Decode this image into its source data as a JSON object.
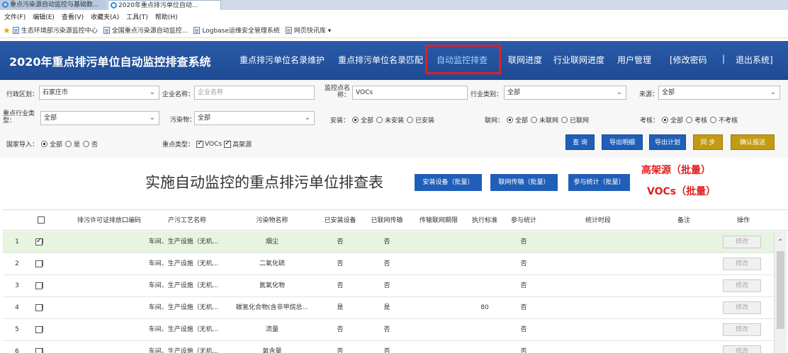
{
  "browser": {
    "tabs": [
      "重点污染源自动监控与基础数...",
      "2020年重点排污单位自动..."
    ],
    "menu": [
      "文件(F)",
      "编辑(E)",
      "查看(V)",
      "收藏夹(A)",
      "工具(T)",
      "帮助(H)"
    ],
    "favorites": [
      "生态环境部污染源监控中心",
      "全国重点污染源自动监控...",
      "Logbase运维安全管理系统",
      "网页快讯库 ▾"
    ]
  },
  "header": {
    "title": "2020年重点排污单位自动监控排查系统",
    "nav": [
      "重点排污单位名录维护",
      "重点排污单位名录匹配",
      "自动监控排查",
      "联网进度",
      "行业联网进度",
      "用户管理",
      "[修改密码",
      "|",
      "退出系统]"
    ]
  },
  "filters": {
    "region_label": "行政区划：",
    "region_value": "石家庄市",
    "company_label": "企业名称：",
    "company_placeholder": "企业名称",
    "monitor_label": "监控点名称：",
    "monitor_value": "VOCs",
    "industry_label": "行业类别：",
    "industry_value": "全部",
    "source_label": "来源：",
    "source_value": "全部",
    "key_industry_label": "重点行业类型：",
    "key_industry_value": "全部",
    "pollutant_label": "污染物：",
    "pollutant_value": "全部",
    "install_label": "安装：",
    "install_options": [
      "全部",
      "未安装",
      "已安装"
    ],
    "network_label": "联网：",
    "network_options": [
      "全部",
      "未联网",
      "已联网"
    ],
    "assess_label": "考核：",
    "assess_options": [
      "全部",
      "考核",
      "不考核"
    ],
    "national_label": "国家导入：",
    "national_options": [
      "全部",
      "是",
      "否"
    ],
    "keytype_label": "重点类型：",
    "keytype_options": [
      "VOCs",
      "高架源"
    ]
  },
  "buttons": {
    "query": "查 询",
    "export_detail": "导出明细",
    "export_plan": "导出计划",
    "sync": "同 步",
    "confirm": "确认报送"
  },
  "main": {
    "title": "实施自动监控的重点排污单位排查表",
    "batch_install": "安装设备（批量）",
    "batch_network": "联网传输（批量）",
    "batch_stats": "参与统计（批量）",
    "note_high": "高架源（批量）",
    "note_vocs": "VOCs（批量）"
  },
  "table": {
    "headers": [
      "排污许可证排放口编码",
      "产污工艺名称",
      "污染物名称",
      "已安装设备",
      "已联网传输",
      "传输联网期限",
      "执行标准",
      "参与统计",
      "统计时段",
      "备注",
      "操作"
    ],
    "edit_label": "修改",
    "rows": [
      {
        "no": "1",
        "checked": true,
        "code": "]",
        "process": "车间、生产设施（无机...",
        "pollutant": "烟尘",
        "installed": "否",
        "networked": "否",
        "deadline": "",
        "standard": "",
        "stats": "否"
      },
      {
        "no": "2",
        "checked": false,
        "code": "]",
        "process": "车间、生产设施（无机...",
        "pollutant": "二氧化硫",
        "installed": "否",
        "networked": "否",
        "deadline": "",
        "standard": "",
        "stats": "否"
      },
      {
        "no": "3",
        "checked": false,
        "code": "]",
        "process": "车间、生产设施（无机...",
        "pollutant": "氮氧化物",
        "installed": "否",
        "networked": "否",
        "deadline": "",
        "standard": "",
        "stats": "否"
      },
      {
        "no": "4",
        "checked": false,
        "code": "]",
        "process": "车间、生产设施（无机...",
        "pollutant": "碳氢化合物(含非甲烷总...",
        "installed": "是",
        "networked": "是",
        "deadline": "",
        "standard": "80",
        "stats": "否"
      },
      {
        "no": "5",
        "checked": false,
        "code": "]",
        "process": "车间、生产设施（无机...",
        "pollutant": "流量",
        "installed": "否",
        "networked": "否",
        "deadline": "",
        "standard": "",
        "stats": "否"
      },
      {
        "no": "6",
        "checked": false,
        "code": "]",
        "process": "车间、生产设施（无机...",
        "pollutant": "氧含量",
        "installed": "否",
        "networked": "否",
        "deadline": "",
        "standard": "",
        "stats": "否"
      }
    ]
  }
}
